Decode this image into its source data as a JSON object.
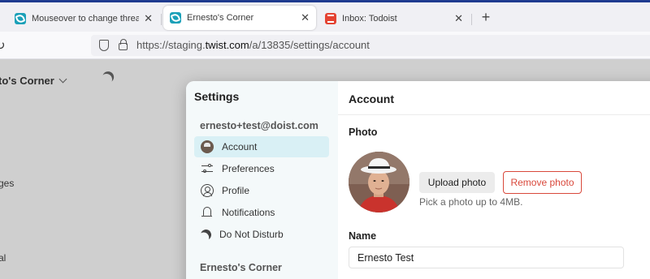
{
  "browser": {
    "tabs": [
      {
        "title": "Mouseover to change thread list",
        "favicon": "twist-icon",
        "active": false
      },
      {
        "title": "Ernesto's Corner",
        "favicon": "twist-icon",
        "active": true
      },
      {
        "title": "Inbox: Todoist",
        "favicon": "todoist-icon",
        "active": false
      }
    ],
    "close_glyph": "✕",
    "new_tab_glyph": "+",
    "url": {
      "prefix": "https://staging.",
      "host": "twist.com",
      "path": "/a/13835/settings/account"
    }
  },
  "app": {
    "workspace_name": "to's Corner",
    "background_fragments": [
      "ges",
      "al"
    ]
  },
  "settings": {
    "title": "Settings",
    "email": "ernesto+test@doist.com",
    "nav": [
      {
        "label": "Account",
        "icon": "avatar-icon",
        "active": true
      },
      {
        "label": "Preferences",
        "icon": "sliders-icon",
        "active": false
      },
      {
        "label": "Profile",
        "icon": "profile-icon",
        "active": false
      },
      {
        "label": "Notifications",
        "icon": "bell-icon",
        "active": false
      },
      {
        "label": "Do Not Disturb",
        "icon": "moon-icon",
        "active": false
      }
    ],
    "workspace_section": "Ernesto's Corner"
  },
  "account": {
    "title": "Account",
    "photo_label": "Photo",
    "upload_label": "Upload photo",
    "remove_label": "Remove photo",
    "photo_hint": "Pick a photo up to 4MB.",
    "name_label": "Name",
    "name_value": "Ernesto Test"
  },
  "colors": {
    "accent_active_nav": "#d9f0f5",
    "danger": "#d9483b",
    "twist_brand": "#1aa0b8",
    "todoist_brand": "#e44332"
  }
}
